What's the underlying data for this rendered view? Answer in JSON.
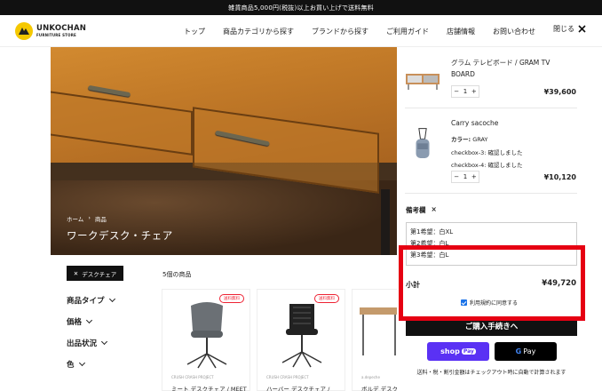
{
  "topbar": {
    "text": "雑貨商品5,000円(税抜)以上お買い上げで送料無料"
  },
  "logo": {
    "main": "UNKOCHAN",
    "sub": "FURNITURE STORE"
  },
  "nav": {
    "items": [
      "トップ",
      "商品カテゴリから探す",
      "ブランドから探す",
      "ご利用ガイド",
      "店舗情報",
      "お問い合わせ"
    ],
    "close_label": "閉じる"
  },
  "hero": {
    "breadcrumb": [
      "ホーム",
      "商品"
    ],
    "title": "ワークデスク・チェア"
  },
  "filters": {
    "active_chip": "デスクチェア",
    "facets": [
      "商品タイプ",
      "価格",
      "出品状況",
      "色"
    ]
  },
  "listing": {
    "count_label": "5個の商品",
    "cards": [
      {
        "badge": "送料無料",
        "brand": "CRUSH CRASH PROJECT",
        "name": "ミート デスクチェア / MEET"
      },
      {
        "badge": "送料無料",
        "brand": "CRUSH CRASH PROJECT",
        "name": "ハーバー デスクチェア /"
      },
      {
        "badge": "",
        "brand": "a.depeche",
        "name": "ボルデ デスク ウ"
      }
    ]
  },
  "cart": {
    "items": [
      {
        "name_line1": "グラム テレビボード / GRAM TV",
        "name_line2": "BOARD",
        "qty": "1",
        "price": "¥39,600"
      },
      {
        "name": "Carry sacoche",
        "variant_label": "カラー:",
        "variant_value": "GRAY",
        "prop1": "checkbox-3: 確認しました",
        "prop2": "checkbox-4: 確認しました",
        "qty": "1",
        "price": "¥10,120"
      }
    ],
    "qty_minus": "−",
    "qty_plus": "+",
    "note_label": "備考欄",
    "note_close": "×",
    "note_lines": [
      "第1希望：白XL",
      "第2希望：白L",
      "第3希望：白L"
    ],
    "subtotal_label": "小計",
    "subtotal_value": "¥49,720",
    "agree_label": "利用規約に同意する",
    "checkout_label": "ご購入手続きへ",
    "shop_pay": {
      "shop": "shop",
      "pay": "Pay"
    },
    "gpay": {
      "g": "G",
      "pay": "Pay"
    },
    "fineprint": "送料・税・割引金額はチェックアウト時に自動で計算されます"
  },
  "colors": {
    "highlight": "#e60012",
    "shop_pay": "#5a31f4",
    "accent_yellow": "#f5c800"
  }
}
